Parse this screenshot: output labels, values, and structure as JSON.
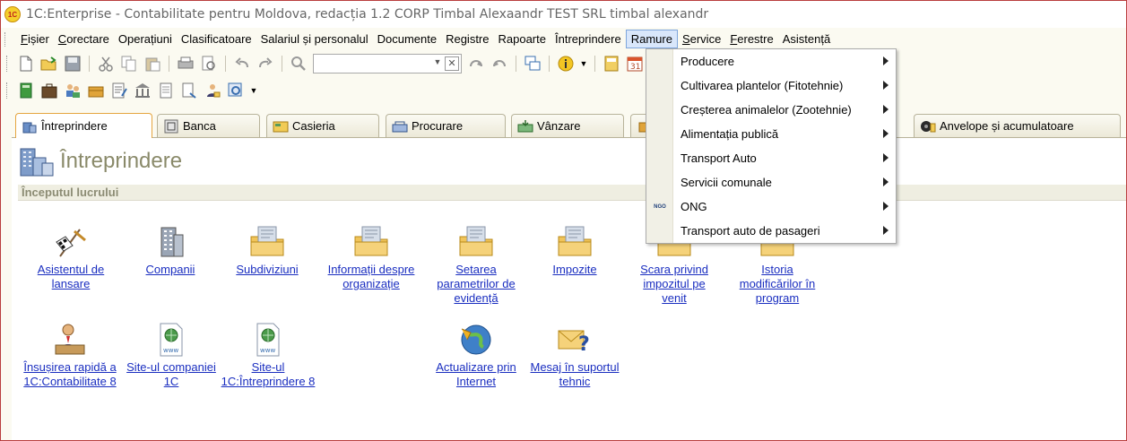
{
  "window": {
    "title": "1C:Enterprise - Contabilitate pentru  Moldova, redacția 1.2 CORP Timbal Alexaandr TEST SRL timbal alexandr",
    "logo_text": "1C"
  },
  "menubar": {
    "items": [
      {
        "label": "Fișier"
      },
      {
        "label": "Corectare"
      },
      {
        "label": "Operațiuni"
      },
      {
        "label": "Clasificatoare"
      },
      {
        "label": "Salariul și personalul"
      },
      {
        "label": "Documente"
      },
      {
        "label": "Registre"
      },
      {
        "label": "Rapoarte"
      },
      {
        "label": "Întreprindere"
      },
      {
        "label": "Ramure"
      },
      {
        "label": "Service"
      },
      {
        "label": "Ferestre"
      },
      {
        "label": "Asistență"
      }
    ]
  },
  "toolbar": {
    "search_value": ""
  },
  "tabs": [
    {
      "label": "Întreprindere",
      "icon": "enterprise-icon"
    },
    {
      "label": "Banca",
      "icon": "bank-icon"
    },
    {
      "label": "Casieria",
      "icon": "cash-icon"
    },
    {
      "label": "Procurare",
      "icon": "purchase-icon"
    },
    {
      "label": "Vânzare",
      "icon": "sale-icon"
    },
    {
      "label": "Anvelope și acumulatoare",
      "icon": "tires-icon"
    }
  ],
  "page": {
    "title": "Întreprindere",
    "section": "Începutul lucrului"
  },
  "launchers": [
    {
      "label": "Asistentul de lansare",
      "icon": "checkered-flag-icon"
    },
    {
      "label": "Companii",
      "icon": "buildings-icon"
    },
    {
      "label": "Subdiviziuni",
      "icon": "folder-icon"
    },
    {
      "label": "Informații despre organizație",
      "icon": "folder-icon"
    },
    {
      "label": "Setarea parametrilor de evidență",
      "icon": "folder-icon"
    },
    {
      "label": "Impozite",
      "icon": "folder-icon"
    },
    {
      "label": "Scara privind impozitul pe venit",
      "icon": "folder-icon"
    },
    {
      "label": "Istoria modificărilor în program",
      "icon": "folder-icon"
    },
    {
      "label": "Însușirea rapidă a 1C:Contabilitate 8",
      "icon": "teacher-icon"
    },
    {
      "label": "Site-ul companiei 1C",
      "icon": "web-page-icon"
    },
    {
      "label": "Site-ul 1C:Întreprindere 8",
      "icon": "web-page-icon"
    },
    {
      "label": "Actualizare prin Internet",
      "icon": "globe-update-icon"
    },
    {
      "label": "Mesaj în suportul tehnic",
      "icon": "mail-question-icon"
    }
  ],
  "ramure_menu": {
    "items": [
      {
        "label": "Producere"
      },
      {
        "label": "Cultivarea plantelor (Fitotehnie)"
      },
      {
        "label": "Creșterea animalelor (Zootehnie)"
      },
      {
        "label": "Alimentația publică"
      },
      {
        "label": "Transport Auto"
      },
      {
        "label": "Servicii comunale"
      },
      {
        "label": "ONG",
        "icon_text": "NGO"
      },
      {
        "label": "Transport auto de pasageri"
      }
    ]
  },
  "colors": {
    "link": "#1a2ec0",
    "accent_border": "#e5a540",
    "window_border": "#b93e3e"
  }
}
